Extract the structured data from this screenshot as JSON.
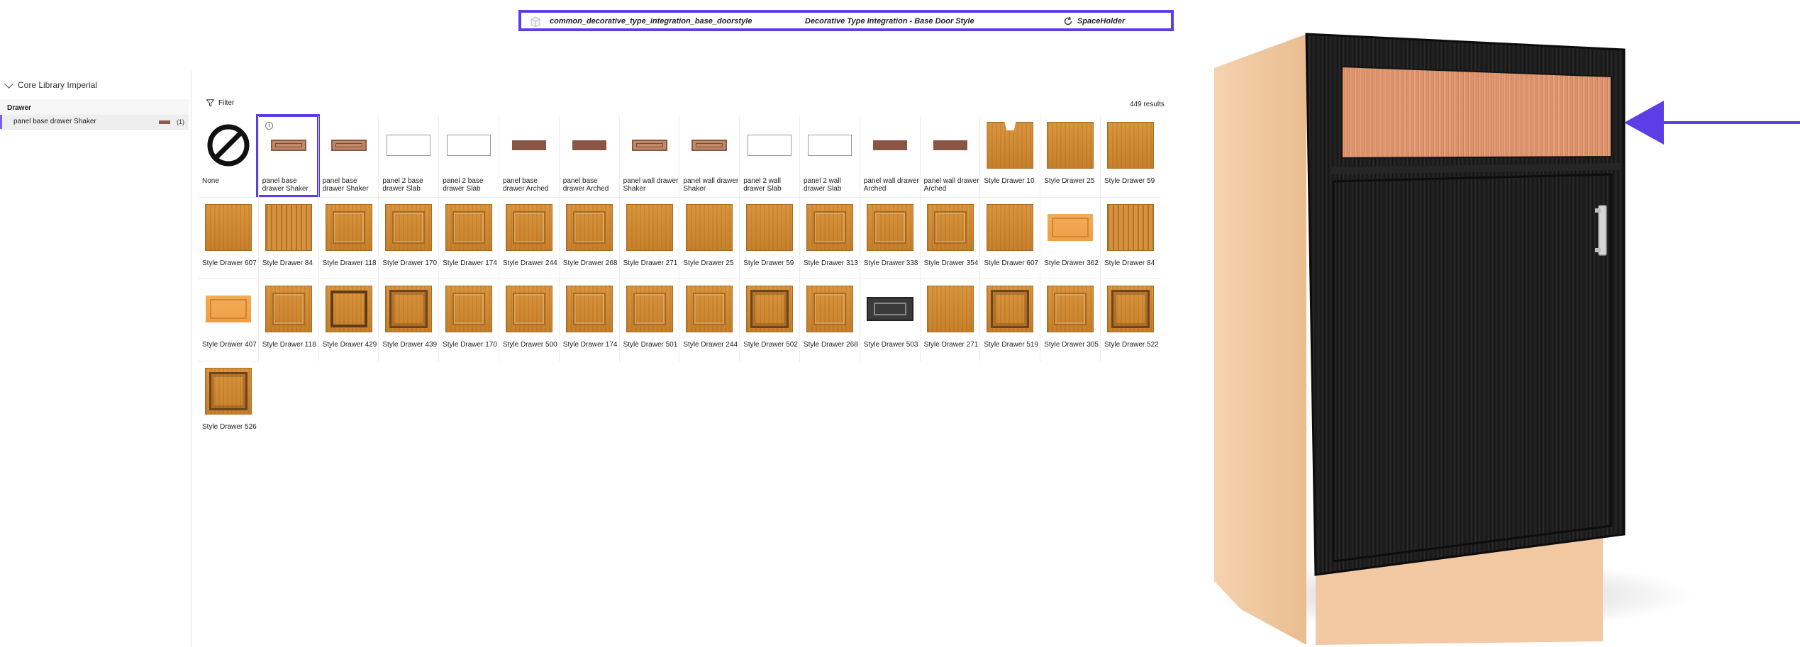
{
  "topbar": {
    "code": "common_decorative_type_integration_base_doorstyle",
    "description": "Decorative Type Integration - Base Door Style",
    "holder": "SpaceHolder"
  },
  "sidebar": {
    "library": "Core Library Imperial",
    "group_title": "Drawer",
    "selected_item": "panel base drawer Shaker",
    "selected_count": "(1)"
  },
  "toolbar": {
    "filter_label": "Filter",
    "results": "449 results"
  },
  "tiles": [
    {
      "label": "None",
      "kind": "none"
    },
    {
      "label": "panel base drawer Shaker",
      "kind": "shaker",
      "selected": true
    },
    {
      "label": "panel base drawer Shaker",
      "kind": "shaker"
    },
    {
      "label": "panel 2 base drawer Slab",
      "kind": "slab"
    },
    {
      "label": "panel 2 base drawer Slab",
      "kind": "slab"
    },
    {
      "label": "panel base drawer Arched",
      "kind": "arched"
    },
    {
      "label": "panel base drawer Arched",
      "kind": "arched"
    },
    {
      "label": "panel wall drawer Shaker",
      "kind": "shaker"
    },
    {
      "label": "panel wall drawer Shaker",
      "kind": "shaker"
    },
    {
      "label": "panel 2 wall drawer Slab",
      "kind": "slab"
    },
    {
      "label": "panel 2 wall drawer Slab",
      "kind": "slab"
    },
    {
      "label": "panel wall drawer Arched",
      "kind": "arched"
    },
    {
      "label": "panel wall drawer Arched",
      "kind": "arched"
    },
    {
      "label": "Style Drawer 10",
      "kind": "notch"
    },
    {
      "label": "Style Drawer 25",
      "kind": "wood"
    },
    {
      "label": "Style Drawer 59",
      "kind": "wood"
    },
    {
      "label": "Style Drawer 607",
      "kind": "wood"
    },
    {
      "label": "Style Drawer 84",
      "kind": "groove"
    },
    {
      "label": "Style Drawer 118",
      "kind": "raised"
    },
    {
      "label": "Style Drawer 170",
      "kind": "raised"
    },
    {
      "label": "Style Drawer 174",
      "kind": "raised"
    },
    {
      "label": "Style Drawer 244",
      "kind": "raised"
    },
    {
      "label": "Style Drawer 268",
      "kind": "raised"
    },
    {
      "label": "Style Drawer 271",
      "kind": "wood"
    },
    {
      "label": "Style Drawer 25",
      "kind": "wood"
    },
    {
      "label": "Style Drawer 59",
      "kind": "wood"
    },
    {
      "label": "Style Drawer 313",
      "kind": "raised"
    },
    {
      "label": "Style Drawer 338",
      "kind": "raised"
    },
    {
      "label": "Style Drawer 354",
      "kind": "raised"
    },
    {
      "label": "Style Drawer 607",
      "kind": "wood"
    },
    {
      "label": "Style Drawer 362",
      "kind": "light"
    },
    {
      "label": "Style Drawer 84",
      "kind": "groove"
    },
    {
      "label": "Style Drawer 407",
      "kind": "light"
    },
    {
      "label": "Style Drawer 118",
      "kind": "raised"
    },
    {
      "label": "Style Drawer 429",
      "kind": "dark"
    },
    {
      "label": "Style Drawer 439",
      "kind": "dark2"
    },
    {
      "label": "Style Drawer 170",
      "kind": "raised"
    },
    {
      "label": "Style Drawer 500",
      "kind": "raised"
    },
    {
      "label": "Style Drawer 174",
      "kind": "raised"
    },
    {
      "label": "Style Drawer 501",
      "kind": "raised"
    },
    {
      "label": "Style Drawer 244",
      "kind": "raised"
    },
    {
      "label": "Style Drawer 502",
      "kind": "dark2"
    },
    {
      "label": "Style Drawer 268",
      "kind": "raised"
    },
    {
      "label": "Style Drawer 503",
      "kind": "black"
    },
    {
      "label": "Style Drawer 271",
      "kind": "wood"
    },
    {
      "label": "Style Drawer 519",
      "kind": "dark2"
    },
    {
      "label": "Style Drawer 305",
      "kind": "raised"
    },
    {
      "label": "Style Drawer 522",
      "kind": "dark2"
    },
    {
      "label": "Style Drawer 526",
      "kind": "dark2"
    }
  ],
  "colors": {
    "accent": "#5b3ee6",
    "selection_bar": "#7b5cf0",
    "door": "#1c1c1c",
    "carcass": "#f0c9a0",
    "drawer_front": "#d9906a"
  }
}
